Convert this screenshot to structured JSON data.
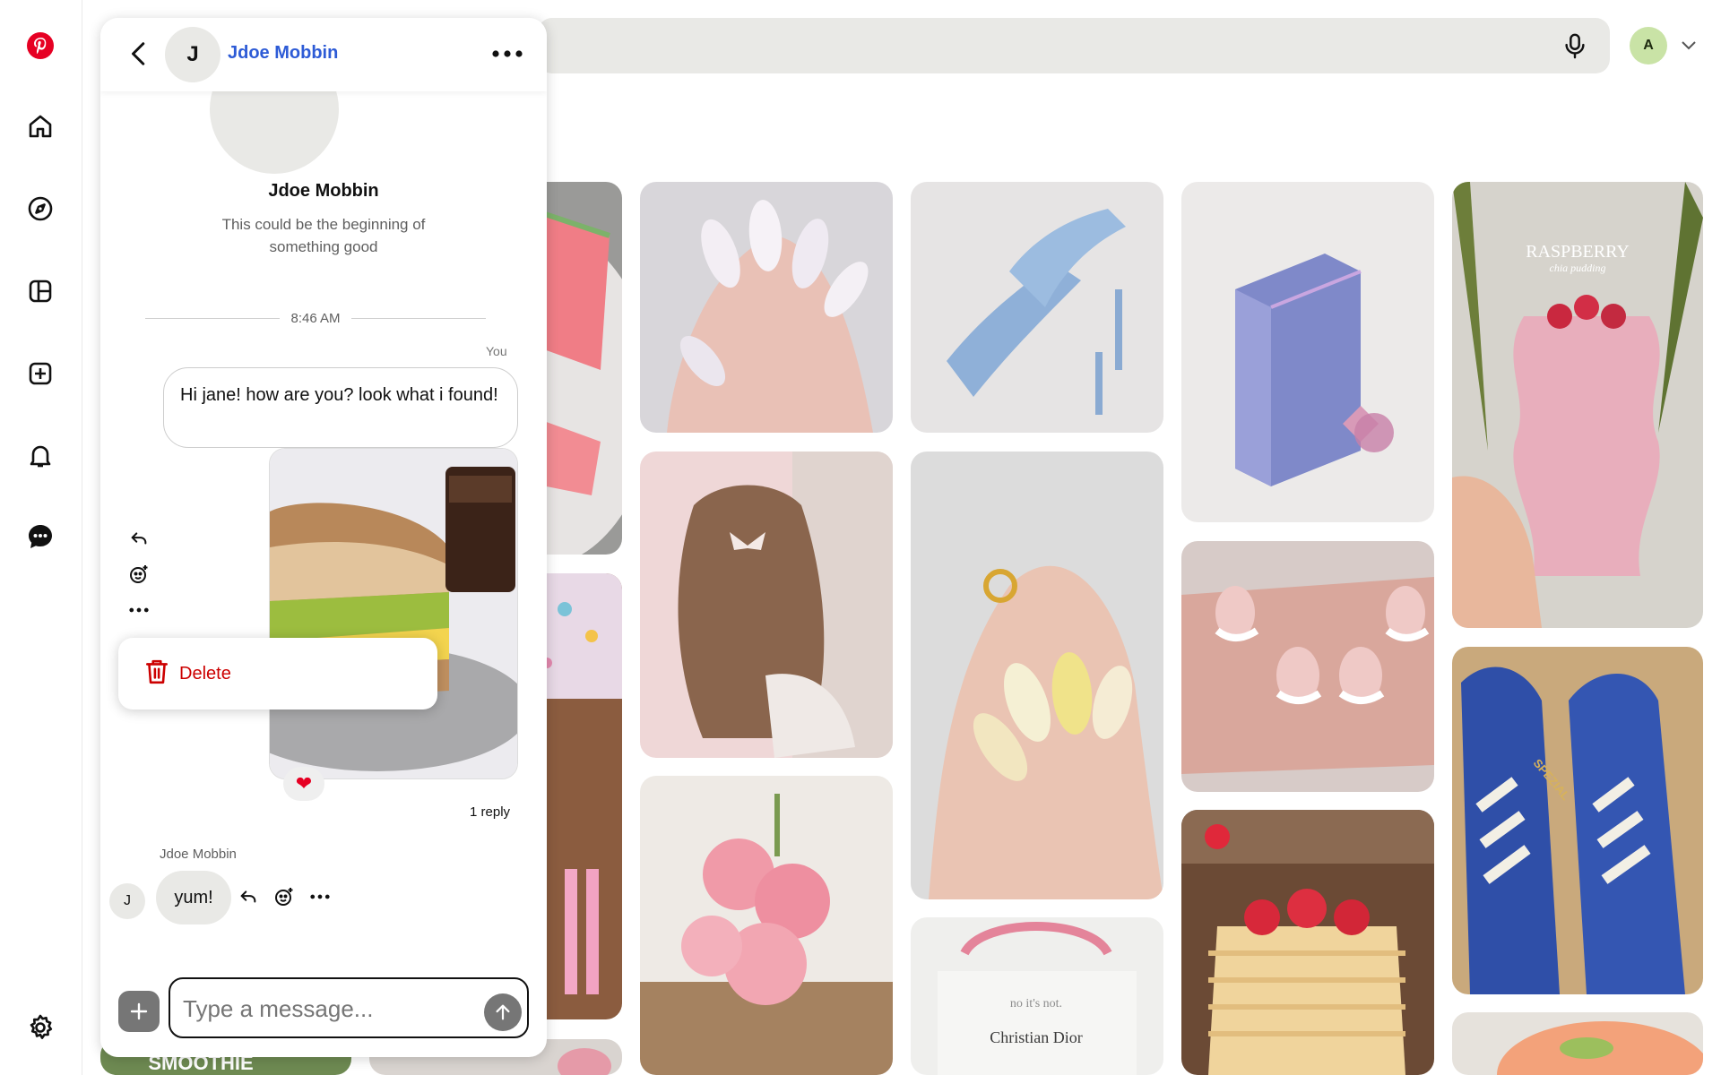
{
  "nav": {
    "items": [
      {
        "name": "pinterest-logo-icon"
      },
      {
        "name": "home-icon"
      },
      {
        "name": "explore-icon"
      },
      {
        "name": "boards-icon"
      },
      {
        "name": "create-icon"
      },
      {
        "name": "notifications-icon"
      },
      {
        "name": "messages-icon"
      },
      {
        "name": "settings-icon"
      }
    ],
    "accent": "#e60023"
  },
  "header": {
    "account_initial": "A",
    "account_color": "#c9e3a6"
  },
  "chat": {
    "contact_initial": "J",
    "contact_name": "Jdoe Mobbin",
    "intro_name": "Jdoe Mobbin",
    "intro_subtitle": "This could be the beginning of something good",
    "timestamp": "8:46 AM",
    "you_label": "You",
    "outgoing_message": "Hi jane! how are you? look what i found!",
    "reaction": "❤",
    "delete_label": "Delete",
    "reply_count": "1 reply",
    "sender_label": "Jdoe Mobbin",
    "incoming_initial": "J",
    "incoming_message": "yum!",
    "composer_placeholder": "Type a message..."
  },
  "pins": [
    {
      "name": "pin-watermelon",
      "caption": ""
    },
    {
      "name": "pin-chrome-nails",
      "caption": ""
    },
    {
      "name": "pin-blue-heels",
      "caption": ""
    },
    {
      "name": "pin-books-box",
      "caption": ""
    },
    {
      "name": "pin-raspberry-pudding",
      "caption": "RASPBERRY",
      "subcaption": "chia pudding"
    },
    {
      "name": "pin-charms",
      "caption": ""
    },
    {
      "name": "pin-hair-bow",
      "caption": ""
    },
    {
      "name": "pin-yellow-nails",
      "caption": ""
    },
    {
      "name": "pin-french-nails",
      "caption": ""
    },
    {
      "name": "pin-adidas-spezial",
      "caption": "SPEZIAL"
    },
    {
      "name": "pin-pink-lilies",
      "caption": ""
    },
    {
      "name": "pin-dior-bag",
      "caption": "no it's not.",
      "subcaption": "Christian Dior"
    },
    {
      "name": "pin-strawberry-cake",
      "caption": ""
    },
    {
      "name": "pin-smoothie",
      "caption": "SMOOTHIE"
    },
    {
      "name": "pin-bottom-partial",
      "caption": ""
    },
    {
      "name": "pin-salmon-toast",
      "caption": ""
    }
  ]
}
